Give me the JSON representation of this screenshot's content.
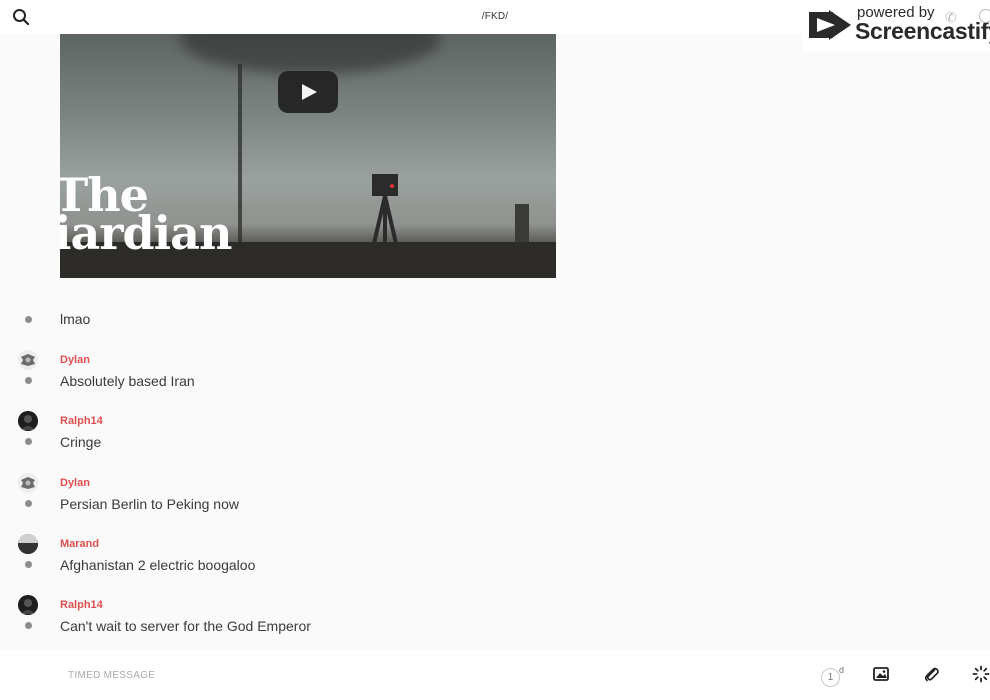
{
  "header": {
    "title": "/FKD/"
  },
  "branding": {
    "powered_label": "powered by",
    "name": "Screencastify"
  },
  "video": {
    "watermark_line1": "The",
    "watermark_line2": "iardian"
  },
  "messages": [
    {
      "author": "",
      "text": "lmao",
      "avatar": "none"
    },
    {
      "author": "Dylan",
      "text": "Absolutely based Iran",
      "avatar": "emblem"
    },
    {
      "author": "Ralph14",
      "text": "Cringe",
      "avatar": "dark-photo"
    },
    {
      "author": "Dylan",
      "text": "Persian Berlin to Peking now",
      "avatar": "emblem"
    },
    {
      "author": "Marand",
      "text": "Afghanistan 2 electric boogaloo",
      "avatar": "landscape"
    },
    {
      "author": "Ralph14",
      "text": "Can't wait to server for the God Emperor",
      "avatar": "dark-photo"
    }
  ],
  "composer": {
    "placeholder": "TIMED MESSAGE",
    "timer_value": "1",
    "timer_unit": "d"
  },
  "colors": {
    "author": "#e05050",
    "background": "#fafafa"
  },
  "icons": {
    "search": "search-icon",
    "play": "play-icon",
    "image": "image-icon",
    "attach": "paperclip-icon",
    "spinner": "loading-spinner-icon"
  }
}
